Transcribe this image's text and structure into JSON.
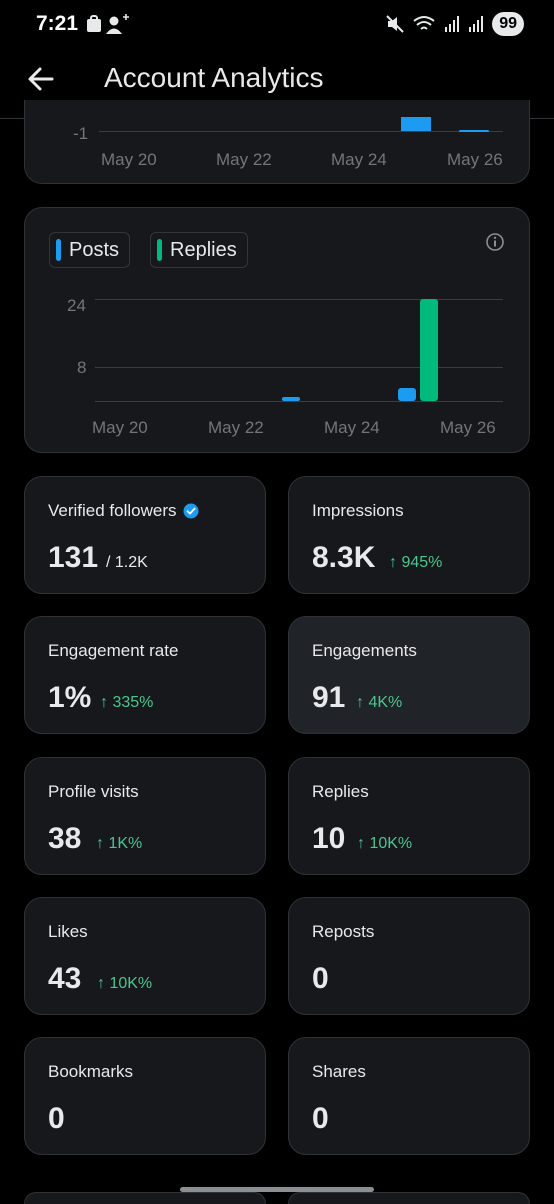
{
  "status_bar": {
    "time": "7:21",
    "battery": "99"
  },
  "header": {
    "title": "Account Analytics"
  },
  "top_chart": {
    "y_tick": "-1",
    "x_ticks": [
      "May 20",
      "May 22",
      "May 24",
      "May 26"
    ]
  },
  "engagement_chart": {
    "legend": {
      "posts_label": "Posts",
      "replies_label": "Replies"
    },
    "y_ticks": [
      "24",
      "8"
    ],
    "x_ticks": [
      "May 20",
      "May 22",
      "May 24",
      "May 26"
    ],
    "colors": {
      "posts": "#1d9bf0",
      "replies": "#00ba7c"
    }
  },
  "chart_data": {
    "type": "bar",
    "categories": [
      "May 20",
      "May 21",
      "May 22",
      "May 23",
      "May 24",
      "May 25",
      "May 26"
    ],
    "series": [
      {
        "name": "Posts",
        "values": [
          0,
          0,
          0,
          1,
          0,
          3,
          0
        ]
      },
      {
        "name": "Replies",
        "values": [
          0,
          0,
          0,
          0,
          0,
          24,
          0
        ]
      }
    ],
    "y_ticks": [
      24,
      8
    ],
    "ylim": [
      0,
      28
    ],
    "legend_position": "top-left",
    "grid": true
  },
  "stats": {
    "verified_followers": {
      "label": "Verified followers",
      "value": "131",
      "sub": "/ 1.2K"
    },
    "impressions": {
      "label": "Impressions",
      "value": "8.3K",
      "delta": "↑ 945%"
    },
    "engagement_rate": {
      "label": "Engagement rate",
      "value": "1%",
      "delta": "↑ 335%"
    },
    "engagements": {
      "label": "Engagements",
      "value": "91",
      "delta": "↑ 4K%"
    },
    "profile_visits": {
      "label": "Profile visits",
      "value": "38",
      "delta": "↑ 1K%"
    },
    "replies": {
      "label": "Replies",
      "value": "10",
      "delta": "↑ 10K%"
    },
    "likes": {
      "label": "Likes",
      "value": "43",
      "delta": "↑ 10K%"
    },
    "reposts": {
      "label": "Reposts",
      "value": "0"
    },
    "bookmarks": {
      "label": "Bookmarks",
      "value": "0"
    },
    "shares": {
      "label": "Shares",
      "value": "0"
    }
  },
  "icons": {
    "back": "arrow-left-icon",
    "info": "info-icon",
    "verified": "verified-badge-icon",
    "mute": "mute-icon",
    "wifi": "wifi-icon",
    "signal": "signal-icon"
  }
}
